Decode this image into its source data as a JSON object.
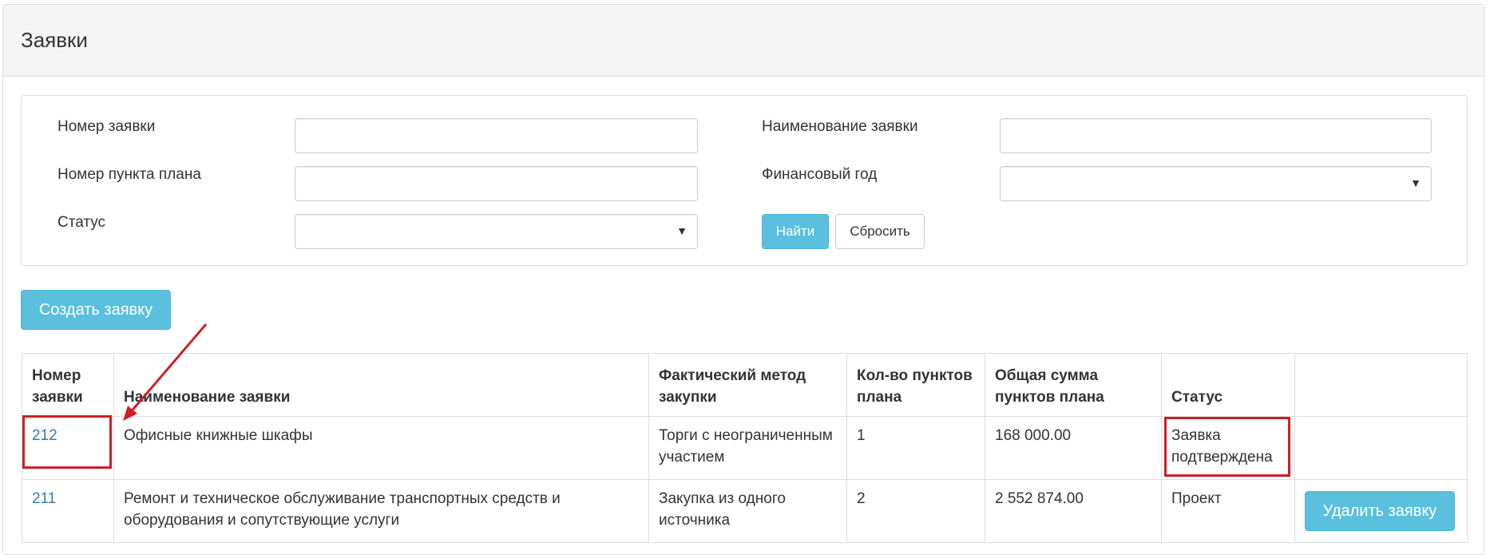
{
  "panel": {
    "title": "Заявки"
  },
  "filters": {
    "request_number_label": "Номер заявки",
    "request_name_label": "Наименование заявки",
    "plan_item_number_label": "Номер пункта плана",
    "fiscal_year_label": "Финансовый год",
    "status_label": "Статус",
    "request_number_value": "",
    "request_name_value": "",
    "plan_item_number_value": "",
    "fiscal_year_value": "",
    "status_value": "",
    "find_button": "Найти",
    "reset_button": "Сбросить"
  },
  "actions": {
    "create_button": "Создать заявку"
  },
  "table": {
    "headers": [
      "Номер заявки",
      "Наименование заявки",
      "Фактический метод закупки",
      "Кол-во пунктов плана",
      "Общая сумма пунктов плана",
      "Статус",
      ""
    ],
    "rows": [
      {
        "number": "212",
        "name": "Офисные книжные шкафы",
        "method": "Торги с неограниченным участием",
        "count": "1",
        "sum": "168 000.00",
        "status": "Заявка подтверждена",
        "action": ""
      },
      {
        "number": "211",
        "name": "Ремонт и техническое обслуживание транспортных средств и оборудования и сопутствующие услуги",
        "method": "Закупка из одного источника",
        "count": "2",
        "sum": "2 552 874.00",
        "status": "Проект",
        "action": "Удалить заявку"
      }
    ]
  },
  "colors": {
    "accent_info": "#5bc0de",
    "link": "#337ab7",
    "highlight": "#cc1f27"
  }
}
